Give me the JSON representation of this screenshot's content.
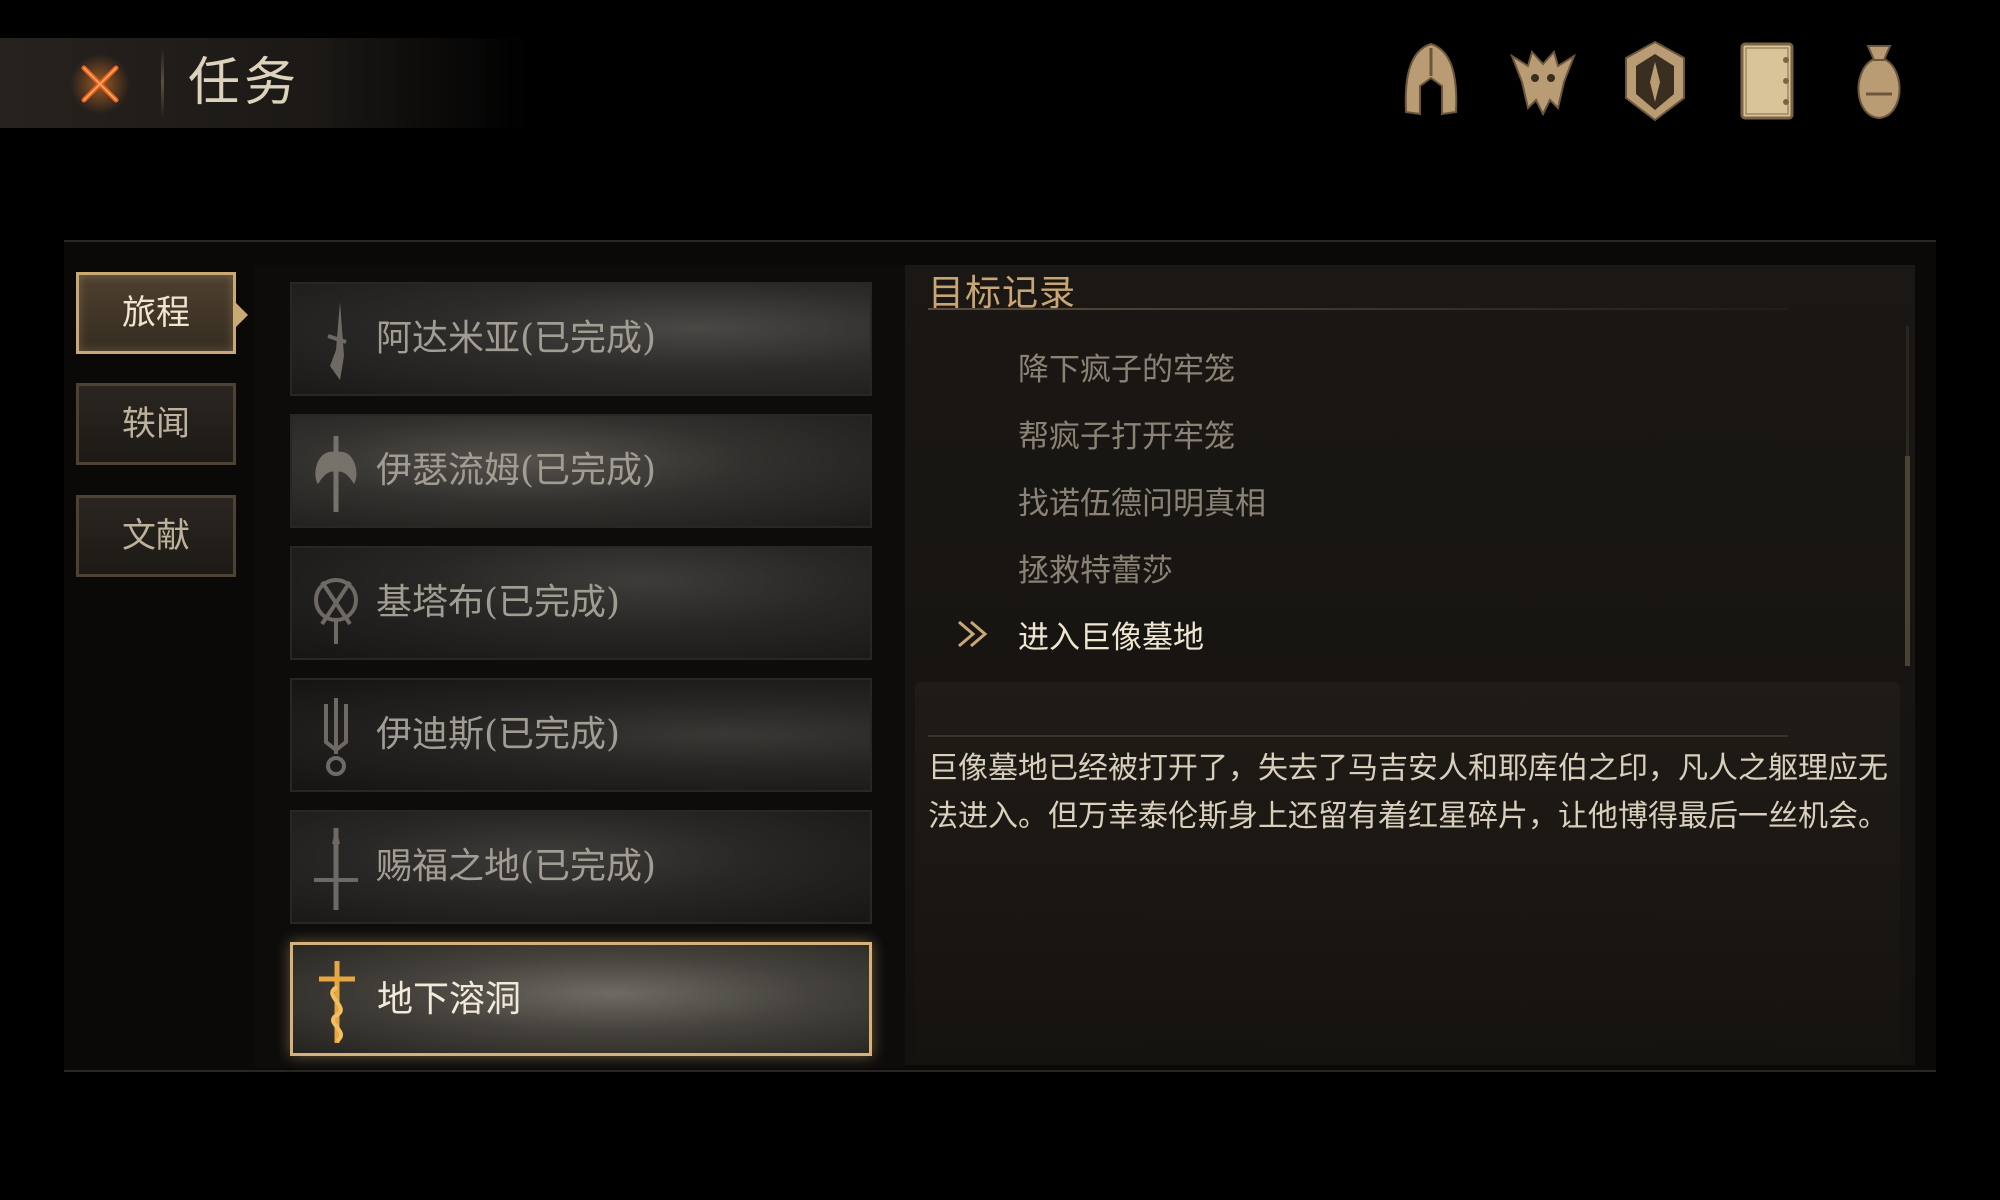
{
  "header": {
    "title": "任务",
    "close_icon": "close-x-icon",
    "icons": [
      {
        "name": "helmet-icon"
      },
      {
        "name": "beast-skull-icon"
      },
      {
        "name": "shield-emblem-icon"
      },
      {
        "name": "journal-book-icon"
      },
      {
        "name": "loot-bag-icon"
      }
    ]
  },
  "categories": [
    {
      "label": "旅程",
      "active": true
    },
    {
      "label": "轶闻",
      "active": false
    },
    {
      "label": "文献",
      "active": false
    }
  ],
  "quests": [
    {
      "label": "阿达米亚(已完成)",
      "icon": "blade-emblem-icon",
      "active": false
    },
    {
      "label": "伊瑟流姆(已完成)",
      "icon": "axe-emblem-icon",
      "active": false
    },
    {
      "label": "基塔布(已完成)",
      "icon": "crossed-swords-emblem-icon",
      "active": false
    },
    {
      "label": "伊迪斯(已完成)",
      "icon": "trident-emblem-icon",
      "active": false
    },
    {
      "label": "赐福之地(已完成)",
      "icon": "sword-cross-emblem-icon",
      "active": false
    },
    {
      "label": "地下溶洞",
      "icon": "serpent-sword-emblem-icon",
      "active": true
    }
  ],
  "detail": {
    "title": "目标记录",
    "objectives": [
      {
        "text": "降下疯子的牢笼",
        "current": false
      },
      {
        "text": "帮疯子打开牢笼",
        "current": false
      },
      {
        "text": "找诺伍德问明真相",
        "current": false
      },
      {
        "text": "拯救特蕾莎",
        "current": false
      },
      {
        "text": "进入巨像墓地",
        "current": true
      }
    ],
    "description": "巨像墓地已经被打开了，失去了马吉安人和耶库伯之印，凡人之躯理应无法进入。但万幸泰伦斯身上还留有着红星碎片，让他博得最后一丝机会。"
  },
  "colors": {
    "accent_gold": "#c9a874",
    "title_gold": "#c8a572",
    "close_orange": "#e0641e"
  }
}
